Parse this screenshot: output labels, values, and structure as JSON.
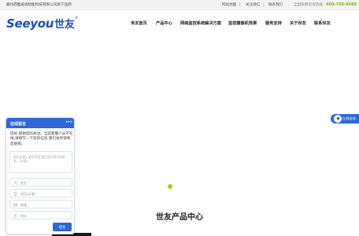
{
  "topbar": {
    "company": "赣州西图威视智能科技有限公司旗下品牌",
    "links": [
      "网站地图",
      "关注微信",
      "联系我们"
    ],
    "hotline_label": "全国免费咨询热线:",
    "hotline_number": "400-700-8089"
  },
  "header": {
    "logo_word": "Seeyou",
    "logo_cn": "世友",
    "logo_mark": "®",
    "nav": [
      "世友首页",
      "产品中心",
      "网络监控系统解决方案",
      "监控摄像机效果",
      "服务支持",
      "关于世友",
      "联系世友"
    ]
  },
  "float_widget": {
    "label": "在线咨询"
  },
  "chat": {
    "title": "在线留言",
    "more": "•••",
    "message": "您好,感谢您的关注。当前客服人员不在线,请填写一下您的信息,我们会尽快和您联系。",
    "textarea_placeholder": "请在此输入留言内容,我们会尽快与您联系。(必填)",
    "fields": [
      {
        "icon": "person-icon",
        "placeholder": "姓名"
      },
      {
        "icon": "phone-icon",
        "placeholder": "电话(必填)"
      },
      {
        "icon": "mail-icon",
        "placeholder": "邮箱"
      },
      {
        "icon": "location-icon",
        "placeholder": "地址"
      }
    ],
    "submit_label": "提交"
  },
  "section": {
    "title": "世友产品中心"
  },
  "colors": {
    "brand_blue": "#1a4fb5",
    "chat_blue": "#2f67d9",
    "accent_green": "#7fb719",
    "carousel_dot": "#9fd021"
  }
}
